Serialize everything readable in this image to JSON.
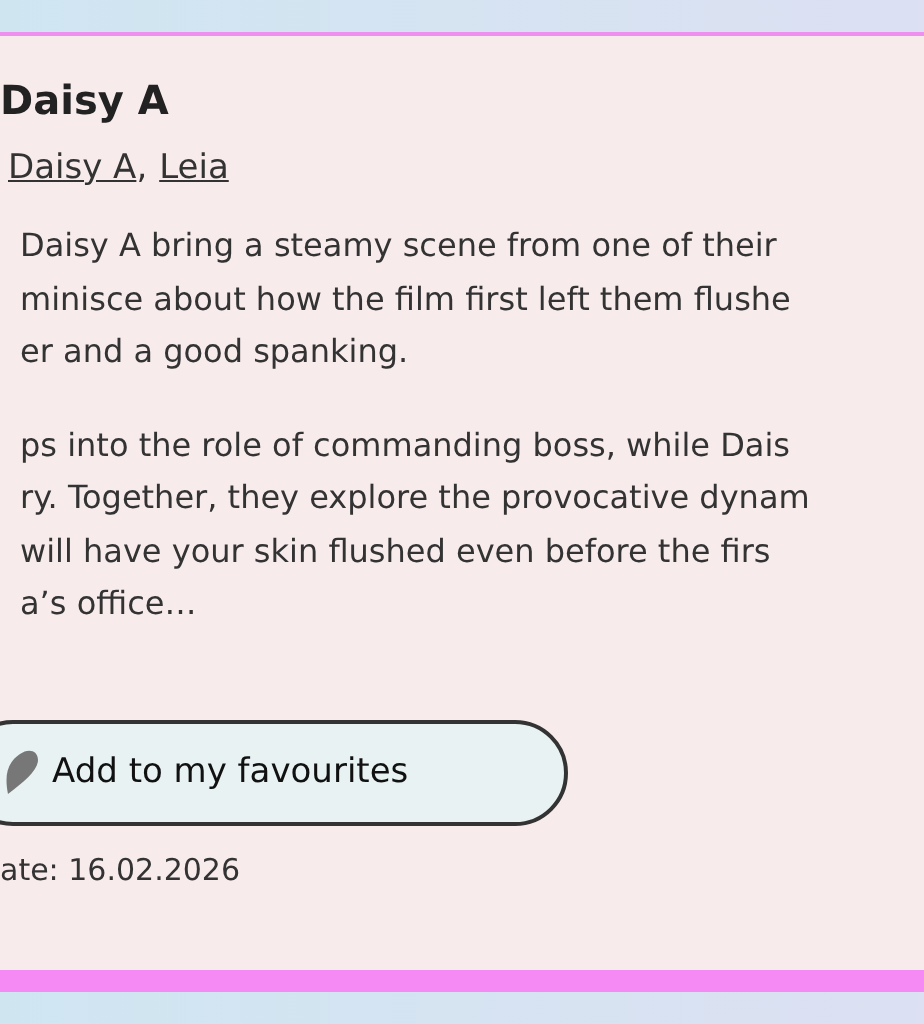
{
  "heading": "Daisy A",
  "performers": [
    {
      "name": "Daisy A"
    },
    {
      "name": "Leia"
    }
  ],
  "performer_separator": ",",
  "description": [
    [
      "Daisy A bring a steamy scene from one of their",
      "minisce about how the film first left them flushe",
      "er and a good spanking."
    ],
    [
      "ps into the role of commanding boss, while Dais",
      "ry. Together, they explore the provocative dynam",
      "will have your skin flushed even before the firs",
      "a’s office…"
    ]
  ],
  "favourite_button": {
    "label": "Add to my favourites"
  },
  "date": "ate: 16.02.2026"
}
